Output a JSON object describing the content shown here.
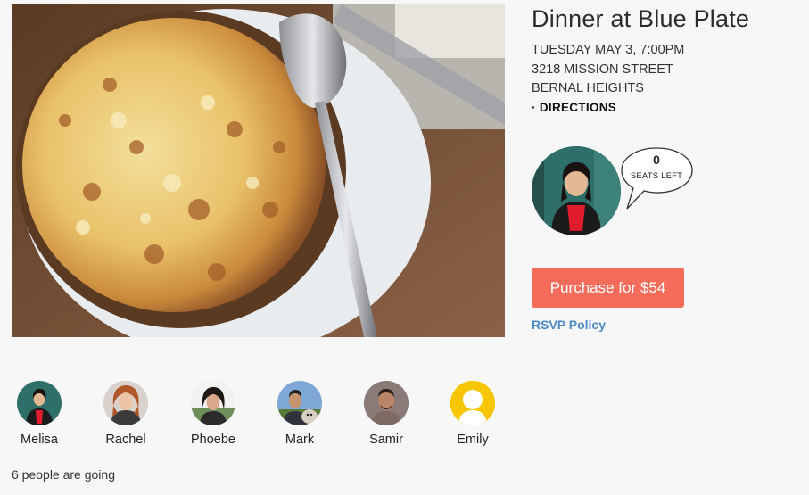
{
  "event": {
    "title": "Dinner at Blue Plate",
    "date_line": "TUESDAY MAY 3, 7:00PM",
    "address_line": "3218 MISSION STREET",
    "neighborhood_line": "BERNAL HEIGHTS",
    "directions_label": "· DIRECTIONS"
  },
  "host": {
    "seats_count": "0",
    "seats_label": "SEATS LEFT"
  },
  "actions": {
    "purchase_label": "Purchase for $54",
    "rsvp_policy_label": "RSVP Policy"
  },
  "attendees": [
    {
      "name": "Melisa"
    },
    {
      "name": "Rachel"
    },
    {
      "name": "Phoebe"
    },
    {
      "name": "Mark"
    },
    {
      "name": "Samir"
    },
    {
      "name": "Emily"
    }
  ],
  "going_text": "6 people are going",
  "colors": {
    "purchase_bg": "#f56c5a",
    "link": "#4b8ac6",
    "placeholder_avatar": "#f7c600"
  }
}
